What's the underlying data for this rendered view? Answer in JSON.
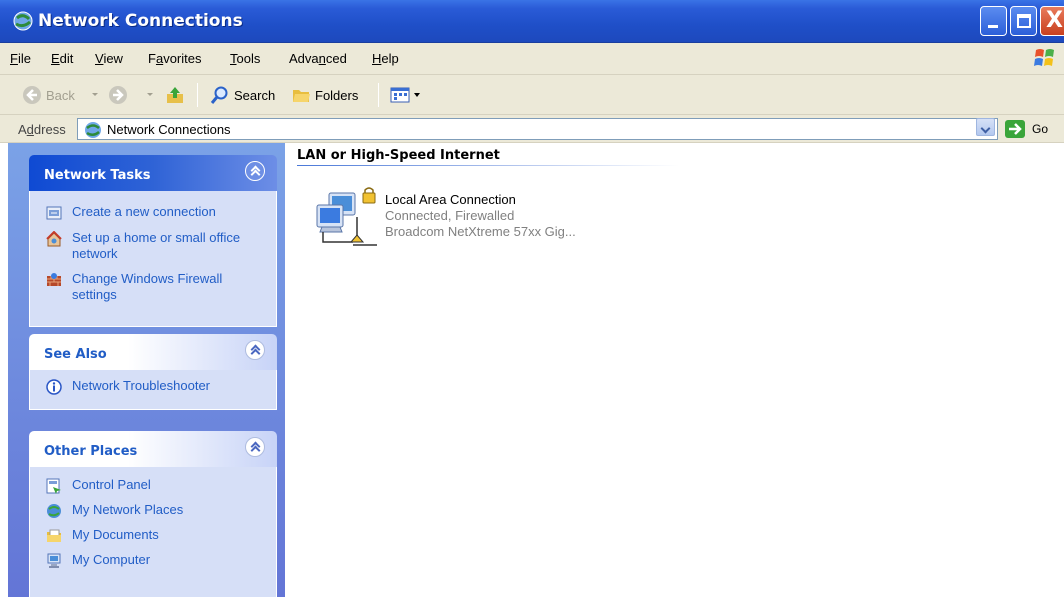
{
  "window": {
    "title": "Network Connections",
    "controls": {
      "minimize": "minimize",
      "maximize": "maximize",
      "close": "X"
    }
  },
  "menu": {
    "items": [
      {
        "label": "File",
        "accel": "F",
        "rest": "ile"
      },
      {
        "label": "Edit",
        "accel": "E",
        "rest": "dit"
      },
      {
        "label": "View",
        "accel": "V",
        "rest": "iew"
      },
      {
        "label": "Favorites",
        "pre": "F",
        "accel": "a",
        "rest": "vorites"
      },
      {
        "label": "Tools",
        "accel": "T",
        "rest": "ools"
      },
      {
        "label": "Advanced",
        "pre": "Adva",
        "accel": "n",
        "rest": "ced"
      },
      {
        "label": "Help",
        "accel": "H",
        "rest": "elp"
      }
    ]
  },
  "toolbar": {
    "back": "Back",
    "search": "Search",
    "folders": "Folders"
  },
  "address": {
    "label_pre": "A",
    "label_accel": "d",
    "label_rest": "dress",
    "value": "Network Connections",
    "go": "Go"
  },
  "taskpane": {
    "network_tasks": {
      "title": "Network Tasks",
      "items": [
        {
          "label": "Create a new connection",
          "icon": "new-connection-icon"
        },
        {
          "label": "Set up a home or small office network",
          "icon": "home-network-icon"
        },
        {
          "label": "Change Windows Firewall settings",
          "icon": "firewall-icon"
        }
      ]
    },
    "see_also": {
      "title": "See Also",
      "items": [
        {
          "label": "Network Troubleshooter",
          "icon": "info-icon"
        }
      ]
    },
    "other_places": {
      "title": "Other Places",
      "items": [
        {
          "label": "Control Panel",
          "icon": "control-panel-icon"
        },
        {
          "label": "My Network Places",
          "icon": "network-places-icon"
        },
        {
          "label": "My Documents",
          "icon": "my-documents-icon"
        },
        {
          "label": "My Computer",
          "icon": "my-computer-icon"
        }
      ]
    }
  },
  "content": {
    "group_title": "LAN or High-Speed Internet",
    "connections": [
      {
        "name": "Local Area Connection",
        "status": "Connected, Firewalled",
        "device": "Broadcom NetXtreme 57xx Gig..."
      }
    ]
  },
  "colors": {
    "titlebar": "#245edb",
    "taskpane_bg": "#7ba2e7",
    "link": "#215dc6",
    "chrome": "#ece9d8"
  }
}
